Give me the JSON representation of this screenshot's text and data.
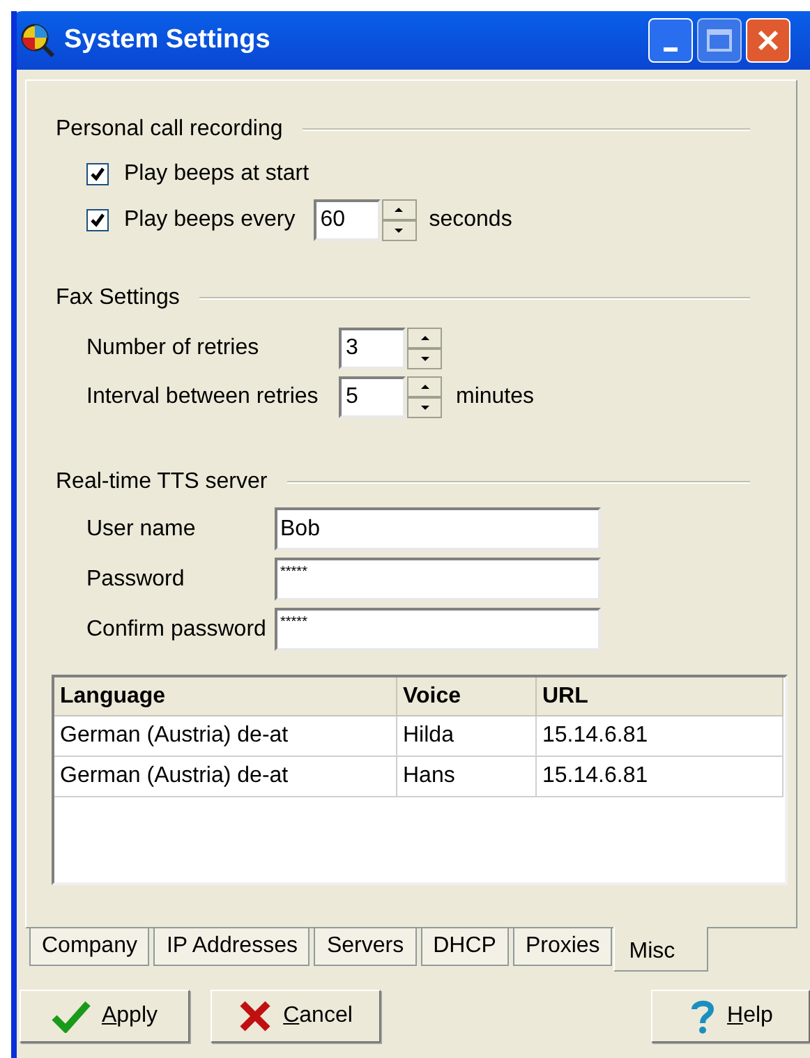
{
  "window": {
    "title": "System Settings"
  },
  "personal_call_recording": {
    "title": "Personal call recording",
    "options": [
      {
        "kind": "checkbox",
        "label": "Play beeps at start",
        "checked": true
      },
      {
        "kind": "spin",
        "label": "Play beeps every",
        "checked": true,
        "value": "60",
        "unit": "seconds"
      }
    ]
  },
  "fax_settings": {
    "title": "Fax Settings",
    "fields": [
      {
        "label": "Number of retries",
        "value": "3"
      },
      {
        "label": "Interval between retries",
        "value": "5",
        "unit": "minutes"
      }
    ]
  },
  "tts_server": {
    "title": "Real-time TTS server",
    "fields": [
      {
        "label": "User name",
        "value": "Bob"
      },
      {
        "label": "Password",
        "value": "*****"
      },
      {
        "label": "Confirm password",
        "value": "*****"
      }
    ],
    "table": {
      "columns": [
        "Language",
        "Voice",
        "URL"
      ],
      "rows": [
        [
          "German (Austria) de-at",
          "Hilda",
          "15.14.6.81"
        ],
        [
          "German (Austria) de-at",
          "Hans",
          "15.14.6.81"
        ]
      ]
    }
  },
  "tabs": [
    {
      "label": "Company",
      "selected": false
    },
    {
      "label": "IP Addresses",
      "selected": false
    },
    {
      "label": "Servers",
      "selected": false
    },
    {
      "label": "DHCP",
      "selected": false
    },
    {
      "label": "Proxies",
      "selected": false
    },
    {
      "label": "Misc",
      "selected": true
    }
  ],
  "buttons": [
    {
      "kind": "apply",
      "label": "Apply"
    },
    {
      "kind": "cancel",
      "label": "Cancel"
    },
    {
      "kind": "help",
      "label": "Help"
    }
  ]
}
